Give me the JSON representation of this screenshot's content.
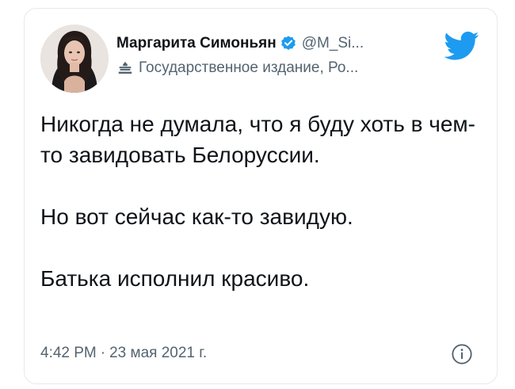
{
  "author": {
    "display_name": "Маргарита Симоньян",
    "handle": "@M_Si...",
    "label": "Государственное издание, Ро..."
  },
  "icons": {
    "verified": "verified-badge-icon",
    "label": "state-media-label-icon",
    "brand": "twitter-bird-icon",
    "info": "info-icon"
  },
  "tweet": {
    "paragraphs": [
      "Никогда не думала, что я буду хоть в чем-то завидовать Белоруссии.",
      "Но вот сейчас как-то завидую.",
      "Батька исполнил красиво."
    ]
  },
  "meta": {
    "time": "4:42 PM",
    "separator": "·",
    "date": "23 мая 2021 г."
  },
  "colors": {
    "brand": "#1d9bf0",
    "text": "#0f1419",
    "secondary": "#536471"
  }
}
